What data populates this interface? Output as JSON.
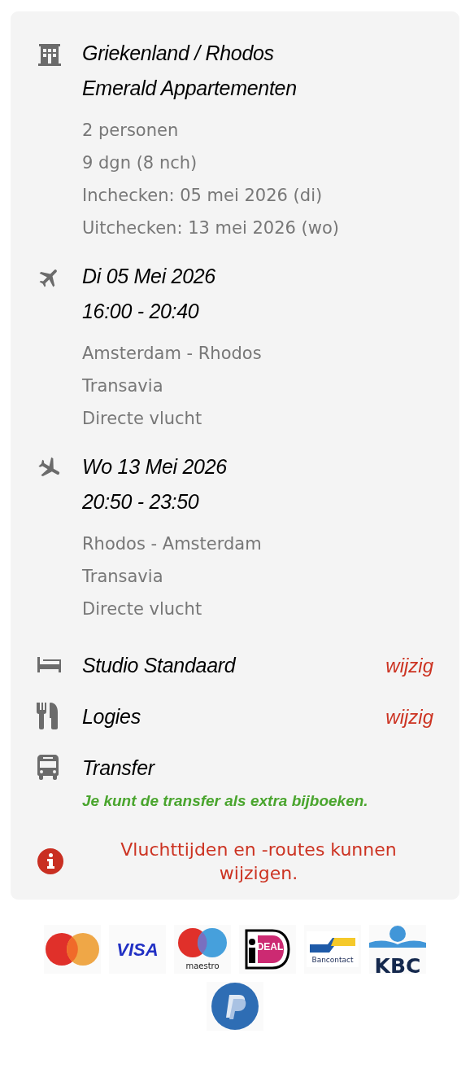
{
  "summary": {
    "sections": [
      {
        "kind": "hotel",
        "titles": [
          "Griekenland / Rhodos",
          "Emerald Appartementen"
        ],
        "details": [
          "2 personen",
          "9 dgn (8 nch)",
          "Inchecken: 05 mei 2026 (di)",
          "Uitchecken: 13 mei 2026 (wo)"
        ]
      },
      {
        "kind": "departure",
        "titles": [
          "Di 05 Mei 2026",
          "16:00 - 20:40"
        ],
        "details": [
          "Amsterdam - Rhodos",
          "Transavia",
          "Directe vlucht"
        ]
      },
      {
        "kind": "arrival",
        "titles": [
          "Wo 13 Mei 2026",
          "20:50 - 23:50"
        ],
        "details": [
          "Rhodos - Amsterdam",
          "Transavia",
          "Directe vlucht"
        ]
      }
    ],
    "options": [
      {
        "kind": "room",
        "label": "Studio Standaard",
        "action": "wijzig"
      },
      {
        "kind": "board",
        "label": "Logies",
        "action": "wijzig"
      },
      {
        "kind": "transfer",
        "label": "Transfer",
        "note": "Je kunt de transfer als extra bijboeken."
      }
    ],
    "notice": "Vluchttijden en -routes kunnen wijzigen."
  },
  "payment_methods": [
    {
      "kind": "mastercard"
    },
    {
      "kind": "visa",
      "label": "VISA"
    },
    {
      "kind": "maestro",
      "label": "maestro"
    },
    {
      "kind": "ideal",
      "label": "DEAL"
    },
    {
      "kind": "bancontact",
      "label": "Bancontact"
    },
    {
      "kind": "kbc",
      "label": "KBC"
    },
    {
      "kind": "paypal"
    }
  ]
}
